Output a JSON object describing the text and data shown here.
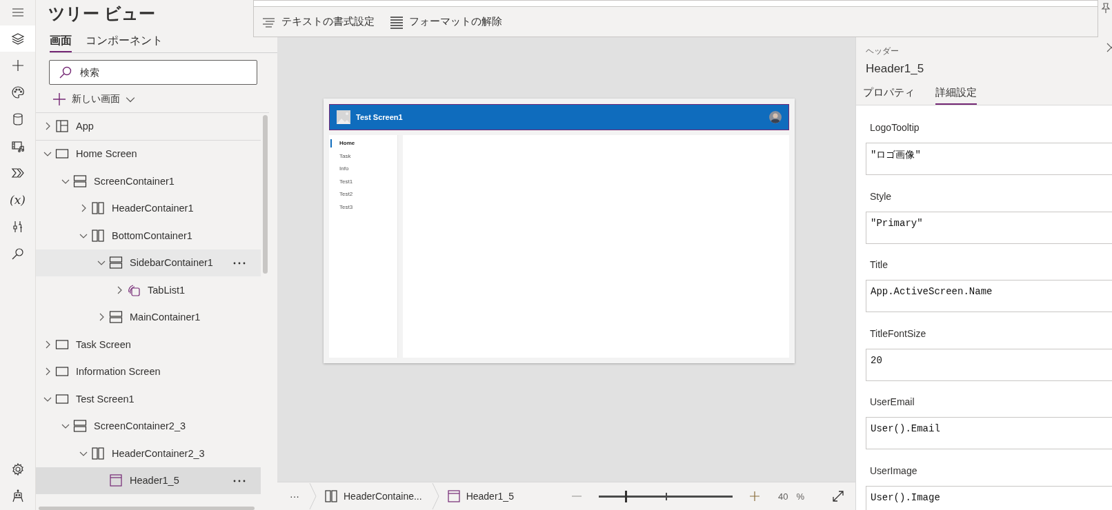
{
  "rail": {
    "items": [
      {
        "kind": "menu",
        "selected": false
      },
      {
        "kind": "layers",
        "selected": true
      },
      {
        "kind": "plus",
        "selected": false
      },
      {
        "kind": "palette",
        "selected": false
      },
      {
        "kind": "database",
        "selected": false
      },
      {
        "kind": "media",
        "selected": false
      },
      {
        "kind": "flow",
        "selected": false
      },
      {
        "kind": "variables",
        "label": "(x)",
        "selected": false
      },
      {
        "kind": "tools",
        "selected": false
      },
      {
        "kind": "search",
        "selected": false
      }
    ],
    "bottom_items": [
      {
        "kind": "settings",
        "selected": false
      },
      {
        "kind": "bot",
        "selected": false
      }
    ]
  },
  "tree_view": {
    "title": "ツリー ビュー",
    "tabs": [
      {
        "label": "画面",
        "selected": true
      },
      {
        "label": "コンポーネント",
        "selected": false
      }
    ],
    "search": {
      "placeholder": "検索"
    },
    "new_screen": "新しい画面",
    "nodes": [
      {
        "label": "App",
        "kind": "app",
        "expanded": false,
        "selected": false,
        "hovered": false
      },
      {
        "label": "Home Screen",
        "kind": "screen",
        "expanded": true,
        "selected": false,
        "hovered": false,
        "children": [
          {
            "label": "ScreenContainer1",
            "kind": "vertical",
            "expanded": true,
            "selected": false,
            "hovered": false,
            "children": [
              {
                "label": "HeaderContainer1",
                "kind": "horizontal",
                "expanded": false,
                "selected": false,
                "hovered": false
              },
              {
                "label": "BottomContainer1",
                "kind": "horizontal",
                "expanded": true,
                "selected": false,
                "hovered": false,
                "children": [
                  {
                    "label": "SidebarContainer1",
                    "kind": "vertical",
                    "expanded": true,
                    "selected": false,
                    "hovered": true,
                    "children": [
                      {
                        "label": "TabList1",
                        "kind": "gallery",
                        "expanded": false,
                        "selected": false,
                        "hovered": false
                      }
                    ]
                  },
                  {
                    "label": "MainContainer1",
                    "kind": "vertical",
                    "expanded": false,
                    "selected": false,
                    "hovered": false
                  }
                ]
              }
            ]
          }
        ]
      },
      {
        "label": "Task Screen",
        "kind": "screen",
        "expanded": false,
        "selected": false,
        "hovered": false
      },
      {
        "label": "Information Screen",
        "kind": "screen",
        "expanded": false,
        "selected": false,
        "hovered": false
      },
      {
        "label": "Test Screen1",
        "kind": "screen",
        "expanded": true,
        "selected": false,
        "hovered": false,
        "children": [
          {
            "label": "ScreenContainer2_3",
            "kind": "vertical",
            "expanded": true,
            "selected": false,
            "hovered": false,
            "children": [
              {
                "label": "HeaderContainer2_3",
                "kind": "horizontal",
                "expanded": true,
                "selected": false,
                "hovered": false,
                "children": [
                  {
                    "label": "Header1_5",
                    "kind": "header",
                    "selected": true,
                    "hovered": false
                  }
                ]
              }
            ]
          }
        ]
      }
    ]
  },
  "format_bar": {
    "items": [
      {
        "label": "テキストの書式設定",
        "kind": "format"
      },
      {
        "label": "フォーマットの解除",
        "kind": "clear"
      }
    ]
  },
  "preview": {
    "title": "Test Screen1",
    "nav": [
      {
        "label": "Home",
        "selected": true
      },
      {
        "label": "Task",
        "selected": false
      },
      {
        "label": "Info",
        "selected": false
      },
      {
        "label": "Test1",
        "selected": false
      },
      {
        "label": "Test2",
        "selected": false
      },
      {
        "label": "Test3",
        "selected": false
      }
    ]
  },
  "status_bar": {
    "more": "···",
    "breadcrumbs": [
      {
        "label": "HeaderContaine...",
        "kind": "horizontal"
      },
      {
        "label": "Header1_5",
        "kind": "header"
      }
    ],
    "zoom": {
      "level": 0.2,
      "value": "40",
      "unit": "%"
    }
  },
  "properties_panel": {
    "type_label": "ヘッダー",
    "name": "Header1_5",
    "tabs": [
      {
        "label": "プロパティ",
        "selected": false
      },
      {
        "label": "詳細設定",
        "selected": true
      }
    ],
    "properties": [
      {
        "name": "LogoTooltip",
        "value": "\"ロゴ画像\""
      },
      {
        "name": "Style",
        "value": "\"Primary\""
      },
      {
        "name": "Title",
        "value": "App.ActiveScreen.Name"
      },
      {
        "name": "TitleFontSize",
        "value": "20"
      },
      {
        "name": "UserEmail",
        "value": "User().Email"
      },
      {
        "name": "UserImage",
        "value": "User().Image"
      }
    ]
  }
}
